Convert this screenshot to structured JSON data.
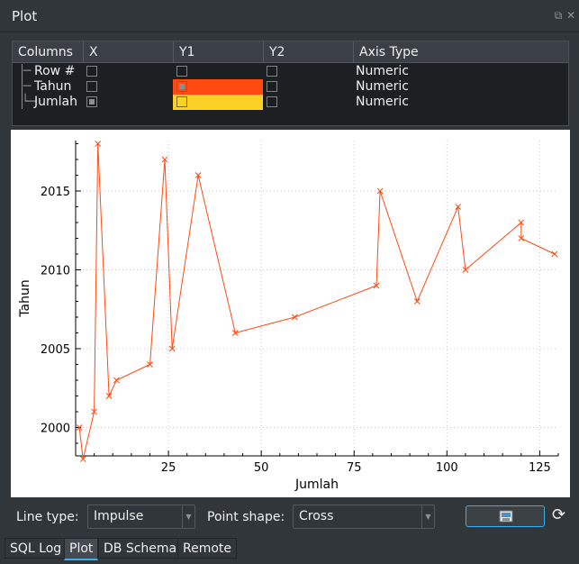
{
  "window": {
    "title": "Plot"
  },
  "columns": {
    "headers": [
      "Columns",
      "X",
      "Y1",
      "Y2",
      "Axis Type"
    ],
    "rows": [
      {
        "name": "Row #",
        "x": false,
        "y1": false,
        "y2": false,
        "axis_type": "Numeric",
        "color": ""
      },
      {
        "name": "Tahun",
        "x": false,
        "y1": true,
        "y2": false,
        "axis_type": "Numeric",
        "color": "#ff4a12"
      },
      {
        "name": "Jumlah",
        "x": true,
        "y1": false,
        "y2": false,
        "axis_type": "Numeric",
        "color": "#fcd126"
      }
    ]
  },
  "chart_data": {
    "type": "line",
    "xlabel": "Jumlah",
    "ylabel": "Tahun",
    "xlim": [
      0,
      130
    ],
    "ylim": [
      1998.2,
      2018.2
    ],
    "x_ticks": [
      25,
      50,
      75,
      100,
      125
    ],
    "y_ticks": [
      2000,
      2005,
      2010,
      2015
    ],
    "grid": true,
    "line_color": "#ff4a12",
    "point_shape": "cross",
    "x": [
      1,
      2,
      5,
      6,
      9,
      11,
      20,
      24,
      26,
      33,
      43,
      59,
      81,
      82,
      92,
      103,
      105,
      120,
      120,
      129
    ],
    "y": [
      2000,
      1998,
      2001,
      2018,
      2002,
      2003,
      2004,
      2017,
      2005,
      2016,
      2006,
      2007,
      2009,
      2015,
      2008,
      2014,
      2010,
      2013,
      2012,
      2011
    ]
  },
  "controls": {
    "line_type_label": "Line type:",
    "line_type_value": "Impulse",
    "point_shape_label": "Point shape:",
    "point_shape_value": "Cross"
  },
  "tabs": [
    {
      "label": "SQL Log",
      "active": false
    },
    {
      "label": "Plot",
      "active": true
    },
    {
      "label": "DB Schema",
      "active": false
    },
    {
      "label": "Remote",
      "active": false
    }
  ]
}
